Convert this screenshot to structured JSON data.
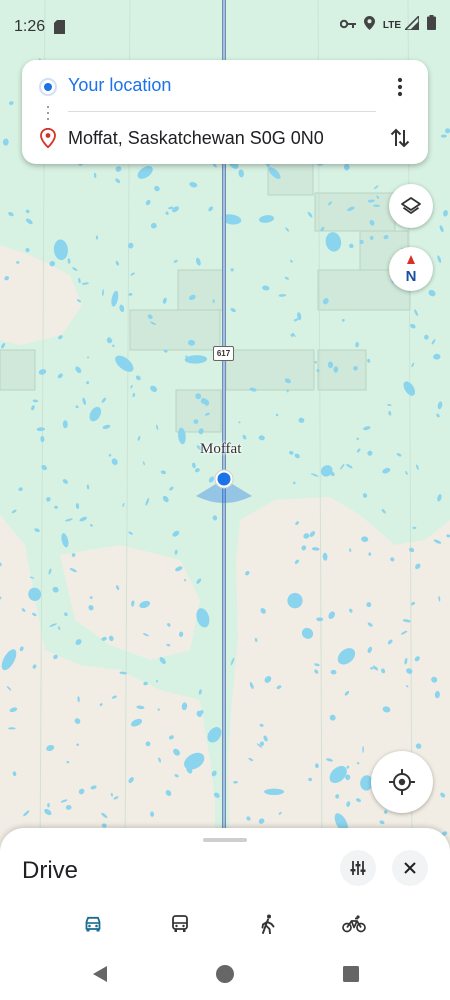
{
  "status_bar": {
    "time": "1:26",
    "network": "LTE",
    "icons": [
      "sd-card-icon",
      "vpn-key-icon",
      "location-icon",
      "signal-icon",
      "battery-icon"
    ]
  },
  "route": {
    "origin": "Your location",
    "destination": "Moffat, Saskatchewan S0G 0N0",
    "origin_color": "#1a73e8",
    "destination_pin_color": "#d93025"
  },
  "map": {
    "place_label": "Moffat",
    "road_shield": "617",
    "compass_letter": "N",
    "colors": {
      "grass": "#d7f2e3",
      "land": "#f1ede4",
      "water": "#8ad4ee",
      "road": "#8da8c9",
      "location": "#1a73e8"
    }
  },
  "sheet": {
    "title": "Drive",
    "modes": [
      {
        "name": "drive-mode",
        "icon": "car-icon",
        "selected": true
      },
      {
        "name": "transit-mode",
        "icon": "bus-icon",
        "selected": false
      },
      {
        "name": "walk-mode",
        "icon": "walking-icon",
        "selected": false
      },
      {
        "name": "bike-mode",
        "icon": "bicycle-icon",
        "selected": false
      }
    ]
  },
  "nav_bar": [
    "back-icon",
    "home-icon",
    "recents-icon"
  ]
}
